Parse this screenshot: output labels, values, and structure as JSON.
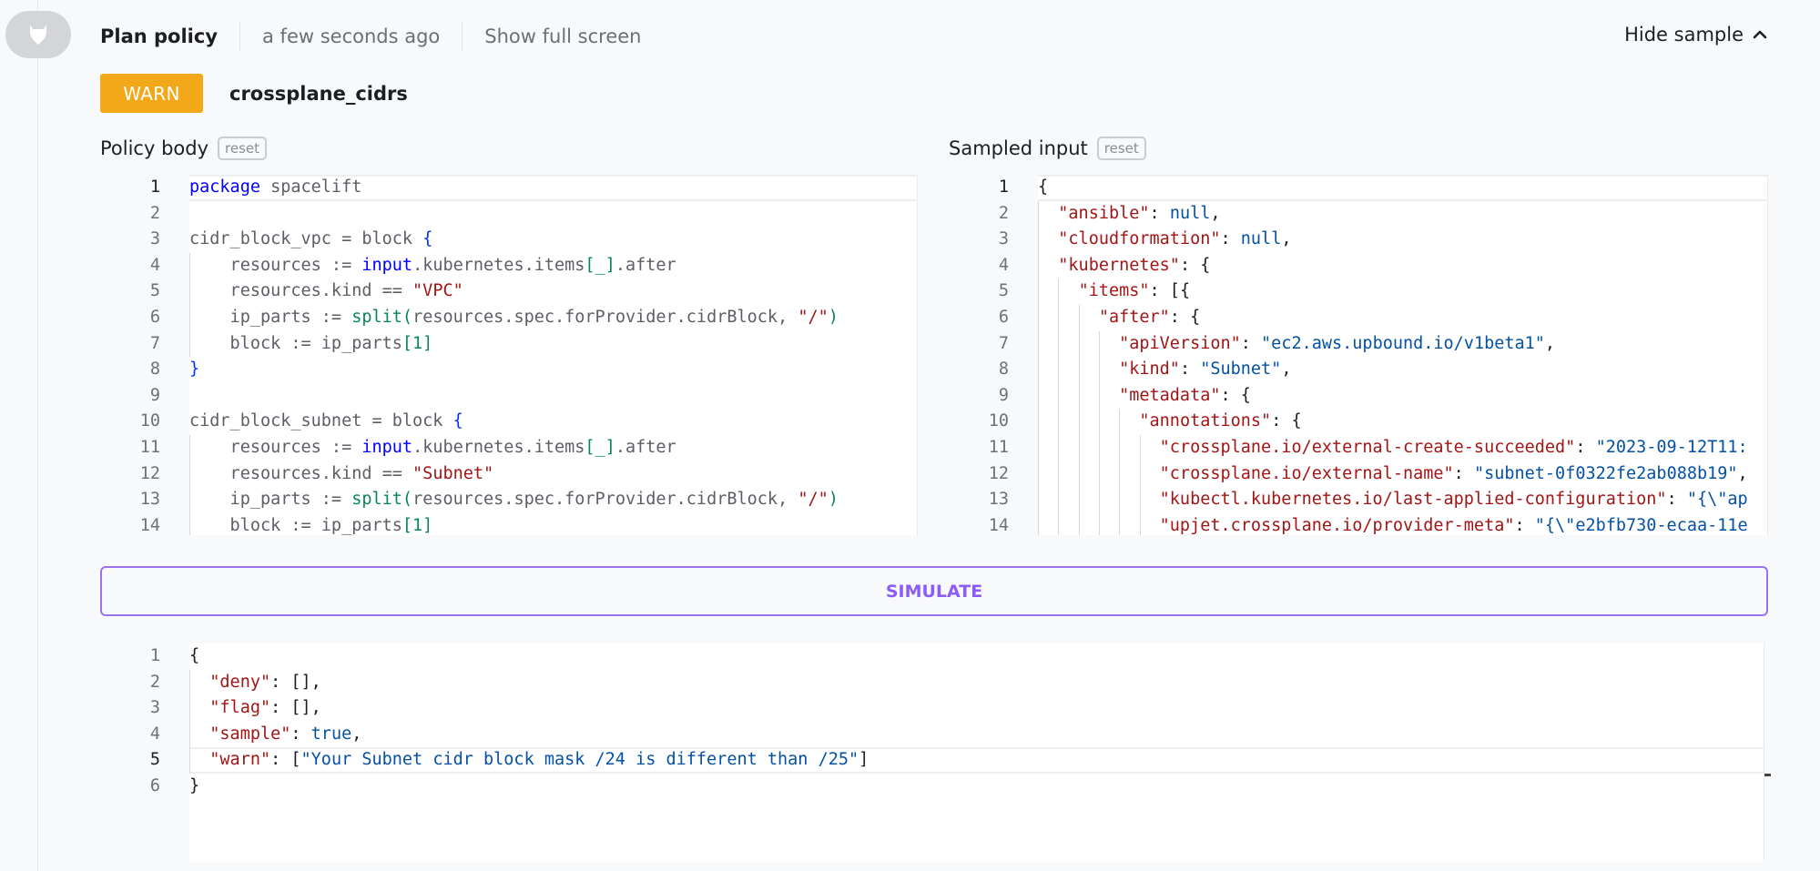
{
  "header": {
    "title": "Plan policy",
    "timestamp": "a few seconds ago",
    "fullscreen_label": "Show full screen",
    "hide_sample_label": "Hide sample",
    "avatar_icon": "spacelift-bull-icon"
  },
  "status": {
    "badge": "WARN",
    "badge_color": "#f2a818",
    "policy_name": "crossplane_cidrs"
  },
  "policy_body": {
    "label": "Policy body",
    "reset_label": "reset",
    "lines": [
      {
        "n": "1",
        "tokens": [
          [
            "k",
            "package"
          ],
          [
            "t",
            " spacelift"
          ]
        ]
      },
      {
        "n": "2",
        "tokens": []
      },
      {
        "n": "3",
        "tokens": [
          [
            "t",
            "cidr_block_vpc = block "
          ],
          [
            "b",
            "{"
          ]
        ]
      },
      {
        "n": "4",
        "tokens": [
          [
            "t",
            "    resources := "
          ],
          [
            "k",
            "input"
          ],
          [
            "t",
            ".kubernetes.items"
          ],
          [
            "p",
            "[_]"
          ],
          [
            "t",
            ".after"
          ]
        ]
      },
      {
        "n": "5",
        "tokens": [
          [
            "t",
            "    resources.kind == "
          ],
          [
            "s",
            "\"VPC\""
          ]
        ]
      },
      {
        "n": "6",
        "tokens": [
          [
            "t",
            "    ip_parts := "
          ],
          [
            "f",
            "split"
          ],
          [
            "p",
            "("
          ],
          [
            "t",
            "resources.spec.forProvider.cidrBlock, "
          ],
          [
            "s",
            "\"/\""
          ],
          [
            "p",
            ")"
          ]
        ]
      },
      {
        "n": "7",
        "tokens": [
          [
            "t",
            "    block := ip_parts"
          ],
          [
            "p",
            "[1]"
          ]
        ]
      },
      {
        "n": "8",
        "tokens": [
          [
            "b",
            "}"
          ]
        ]
      },
      {
        "n": "9",
        "tokens": []
      },
      {
        "n": "10",
        "tokens": [
          [
            "t",
            "cidr_block_subnet = block "
          ],
          [
            "b",
            "{"
          ]
        ]
      },
      {
        "n": "11",
        "tokens": [
          [
            "t",
            "    resources := "
          ],
          [
            "k",
            "input"
          ],
          [
            "t",
            ".kubernetes.items"
          ],
          [
            "p",
            "[_]"
          ],
          [
            "t",
            ".after"
          ]
        ]
      },
      {
        "n": "12",
        "tokens": [
          [
            "t",
            "    resources.kind == "
          ],
          [
            "s",
            "\"Subnet\""
          ]
        ]
      },
      {
        "n": "13",
        "tokens": [
          [
            "t",
            "    ip_parts := "
          ],
          [
            "f",
            "split"
          ],
          [
            "p",
            "("
          ],
          [
            "t",
            "resources.spec.forProvider.cidrBlock, "
          ],
          [
            "s",
            "\"/\""
          ],
          [
            "p",
            ")"
          ]
        ]
      },
      {
        "n": "14",
        "tokens": [
          [
            "t",
            "    block := ip_parts"
          ],
          [
            "p",
            "[1]"
          ]
        ]
      }
    ]
  },
  "sampled_input": {
    "label": "Sampled input",
    "reset_label": "reset",
    "lines": [
      {
        "n": "1",
        "tokens": [
          [
            "j",
            "{"
          ]
        ]
      },
      {
        "n": "2",
        "tokens": [
          [
            "j",
            "  "
          ],
          [
            "k",
            "\"ansible\""
          ],
          [
            "j",
            ": "
          ],
          [
            "v",
            "null"
          ],
          [
            "j",
            ","
          ]
        ]
      },
      {
        "n": "3",
        "tokens": [
          [
            "j",
            "  "
          ],
          [
            "k",
            "\"cloudformation\""
          ],
          [
            "j",
            ": "
          ],
          [
            "v",
            "null"
          ],
          [
            "j",
            ","
          ]
        ]
      },
      {
        "n": "4",
        "tokens": [
          [
            "j",
            "  "
          ],
          [
            "k",
            "\"kubernetes\""
          ],
          [
            "j",
            ": {"
          ]
        ]
      },
      {
        "n": "5",
        "tokens": [
          [
            "j",
            "    "
          ],
          [
            "k",
            "\"items\""
          ],
          [
            "j",
            ": [{"
          ]
        ]
      },
      {
        "n": "6",
        "tokens": [
          [
            "j",
            "      "
          ],
          [
            "k",
            "\"after\""
          ],
          [
            "j",
            ": {"
          ]
        ]
      },
      {
        "n": "7",
        "tokens": [
          [
            "j",
            "        "
          ],
          [
            "k",
            "\"apiVersion\""
          ],
          [
            "j",
            ": "
          ],
          [
            "v",
            "\"ec2.aws.upbound.io/v1beta1\""
          ],
          [
            "j",
            ","
          ]
        ]
      },
      {
        "n": "8",
        "tokens": [
          [
            "j",
            "        "
          ],
          [
            "k",
            "\"kind\""
          ],
          [
            "j",
            ": "
          ],
          [
            "v",
            "\"Subnet\""
          ],
          [
            "j",
            ","
          ]
        ]
      },
      {
        "n": "9",
        "tokens": [
          [
            "j",
            "        "
          ],
          [
            "k",
            "\"metadata\""
          ],
          [
            "j",
            ": {"
          ]
        ]
      },
      {
        "n": "10",
        "tokens": [
          [
            "j",
            "          "
          ],
          [
            "k",
            "\"annotations\""
          ],
          [
            "j",
            ": {"
          ]
        ]
      },
      {
        "n": "11",
        "tokens": [
          [
            "j",
            "            "
          ],
          [
            "k",
            "\"crossplane.io/external-create-succeeded\""
          ],
          [
            "j",
            ": "
          ],
          [
            "v",
            "\"2023-09-12T11:"
          ]
        ]
      },
      {
        "n": "12",
        "tokens": [
          [
            "j",
            "            "
          ],
          [
            "k",
            "\"crossplane.io/external-name\""
          ],
          [
            "j",
            ": "
          ],
          [
            "v",
            "\"subnet-0f0322fe2ab088b19\""
          ],
          [
            "j",
            ","
          ]
        ]
      },
      {
        "n": "13",
        "tokens": [
          [
            "j",
            "            "
          ],
          [
            "k",
            "\"kubectl.kubernetes.io/last-applied-configuration\""
          ],
          [
            "j",
            ": "
          ],
          [
            "v",
            "\"{\\\"ap"
          ]
        ]
      },
      {
        "n": "14",
        "tokens": [
          [
            "j",
            "            "
          ],
          [
            "k",
            "\"upjet.crossplane.io/provider-meta\""
          ],
          [
            "j",
            ": "
          ],
          [
            "v",
            "\"{\\\"e2bfb730-ecaa-11e"
          ]
        ]
      }
    ]
  },
  "simulate_label": "SIMULATE",
  "result": {
    "lines": [
      {
        "n": "1",
        "tokens": [
          [
            "j",
            "{"
          ]
        ]
      },
      {
        "n": "2",
        "tokens": [
          [
            "j",
            "  "
          ],
          [
            "k",
            "\"deny\""
          ],
          [
            "j",
            ": [],"
          ]
        ]
      },
      {
        "n": "3",
        "tokens": [
          [
            "j",
            "  "
          ],
          [
            "k",
            "\"flag\""
          ],
          [
            "j",
            ": [],"
          ]
        ]
      },
      {
        "n": "4",
        "tokens": [
          [
            "j",
            "  "
          ],
          [
            "k",
            "\"sample\""
          ],
          [
            "j",
            ": "
          ],
          [
            "v",
            "true"
          ],
          [
            "j",
            ","
          ]
        ]
      },
      {
        "n": "5",
        "tokens": [
          [
            "j",
            "  "
          ],
          [
            "k",
            "\"warn\""
          ],
          [
            "j",
            ": ["
          ],
          [
            "v",
            "\"Your Subnet cidr block mask /24 is different than /25\""
          ],
          [
            "j",
            "]"
          ]
        ]
      },
      {
        "n": "6",
        "tokens": [
          [
            "j",
            "}"
          ]
        ]
      }
    ]
  }
}
